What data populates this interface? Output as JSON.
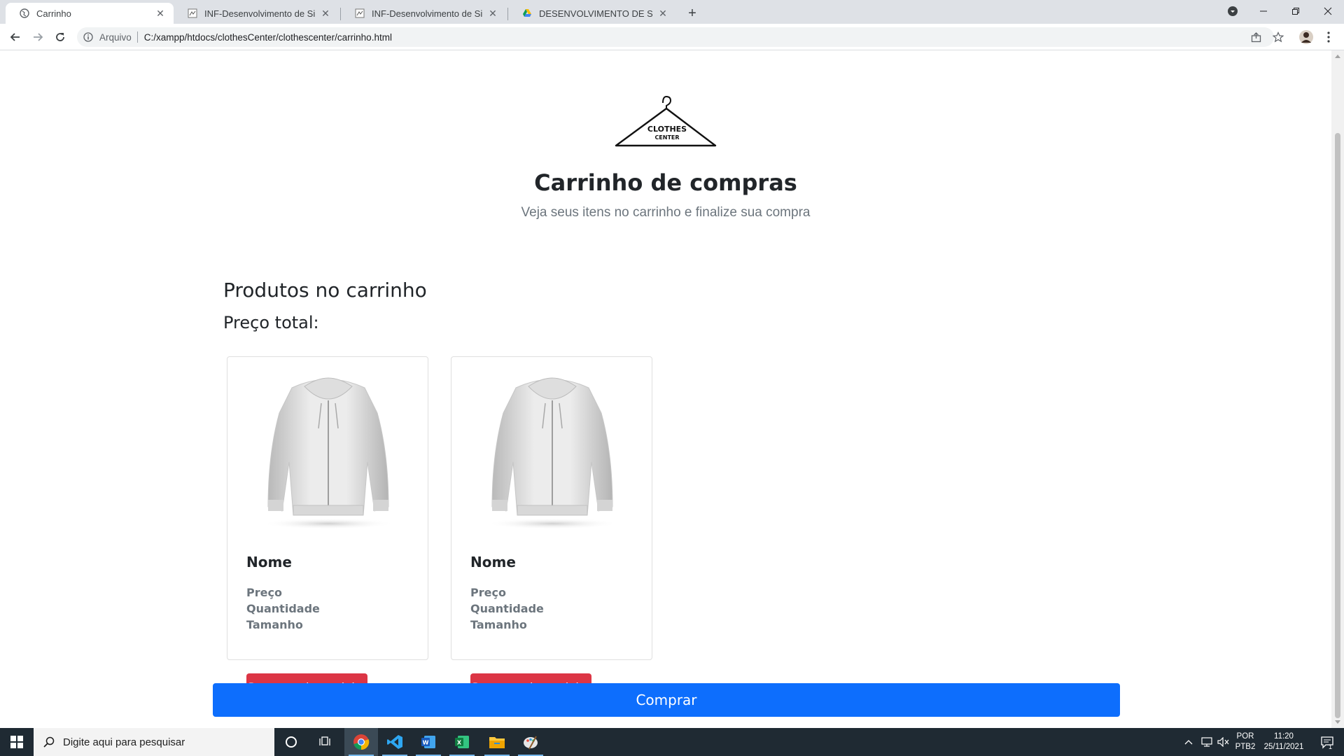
{
  "browser": {
    "tabs": [
      {
        "title": "Carrinho",
        "active": true,
        "icon": "globe-icon"
      },
      {
        "title": "INF-Desenvolvimento de Sistemas",
        "active": false,
        "icon": "document-icon"
      },
      {
        "title": "INF-Desenvolvimento de Sistemas",
        "active": false,
        "icon": "document-icon"
      },
      {
        "title": "DESENVOLVIMENTO DE SISTEMAS",
        "active": false,
        "icon": "google-drive-icon"
      }
    ],
    "address_label": "Arquivo",
    "url": "C:/xampp/htdocs/clothesCenter/clothescenter/carrinho.html"
  },
  "page": {
    "logo": {
      "line1": "CLOTHES",
      "line2": "CENTER"
    },
    "title": "Carrinho de compras",
    "subtitle": "Veja seus itens no carrinho e finalize sua compra",
    "section_title": "Produtos no carrinho",
    "total_label": "Preço total:",
    "products": [
      {
        "name": "Nome",
        "price": "Preço",
        "quantity": "Quantidade",
        "size": "Tamanho",
        "remove_label": "Remover do carrinho"
      },
      {
        "name": "Nome",
        "price": "Preço",
        "quantity": "Quantidade",
        "size": "Tamanho",
        "remove_label": "Remover do carrinho"
      }
    ],
    "buy_label": "Comprar"
  },
  "taskbar": {
    "search_placeholder": "Digite aqui para pesquisar",
    "lang_line1": "POR",
    "lang_line2": "PTB2",
    "time": "11:20",
    "date": "25/11/2021",
    "notifications": "1"
  },
  "colors": {
    "danger": "#dc3545",
    "primary": "#0d6efd",
    "taskbar": "#1f2a33"
  }
}
